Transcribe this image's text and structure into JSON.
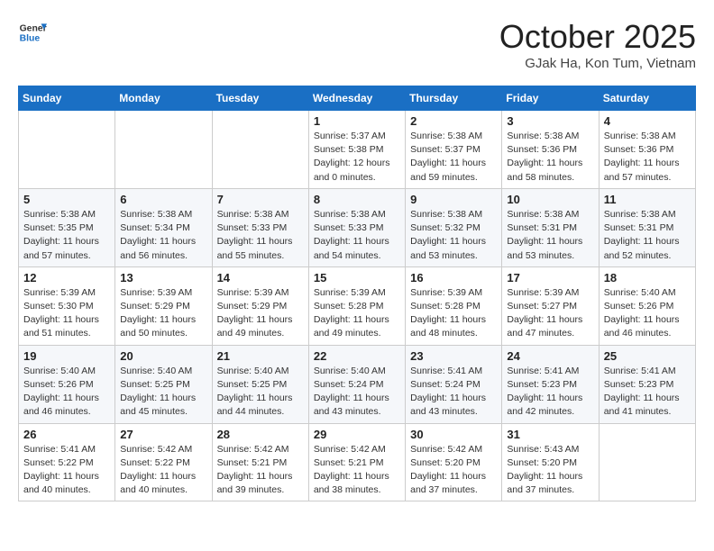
{
  "header": {
    "logo_line1": "General",
    "logo_line2": "Blue",
    "month": "October 2025",
    "location": "GJak Ha, Kon Tum, Vietnam"
  },
  "days_of_week": [
    "Sunday",
    "Monday",
    "Tuesday",
    "Wednesday",
    "Thursday",
    "Friday",
    "Saturday"
  ],
  "weeks": [
    [
      {
        "day": "",
        "info": ""
      },
      {
        "day": "",
        "info": ""
      },
      {
        "day": "",
        "info": ""
      },
      {
        "day": "1",
        "info": "Sunrise: 5:37 AM\nSunset: 5:38 PM\nDaylight: 12 hours\nand 0 minutes."
      },
      {
        "day": "2",
        "info": "Sunrise: 5:38 AM\nSunset: 5:37 PM\nDaylight: 11 hours\nand 59 minutes."
      },
      {
        "day": "3",
        "info": "Sunrise: 5:38 AM\nSunset: 5:36 PM\nDaylight: 11 hours\nand 58 minutes."
      },
      {
        "day": "4",
        "info": "Sunrise: 5:38 AM\nSunset: 5:36 PM\nDaylight: 11 hours\nand 57 minutes."
      }
    ],
    [
      {
        "day": "5",
        "info": "Sunrise: 5:38 AM\nSunset: 5:35 PM\nDaylight: 11 hours\nand 57 minutes."
      },
      {
        "day": "6",
        "info": "Sunrise: 5:38 AM\nSunset: 5:34 PM\nDaylight: 11 hours\nand 56 minutes."
      },
      {
        "day": "7",
        "info": "Sunrise: 5:38 AM\nSunset: 5:33 PM\nDaylight: 11 hours\nand 55 minutes."
      },
      {
        "day": "8",
        "info": "Sunrise: 5:38 AM\nSunset: 5:33 PM\nDaylight: 11 hours\nand 54 minutes."
      },
      {
        "day": "9",
        "info": "Sunrise: 5:38 AM\nSunset: 5:32 PM\nDaylight: 11 hours\nand 53 minutes."
      },
      {
        "day": "10",
        "info": "Sunrise: 5:38 AM\nSunset: 5:31 PM\nDaylight: 11 hours\nand 53 minutes."
      },
      {
        "day": "11",
        "info": "Sunrise: 5:38 AM\nSunset: 5:31 PM\nDaylight: 11 hours\nand 52 minutes."
      }
    ],
    [
      {
        "day": "12",
        "info": "Sunrise: 5:39 AM\nSunset: 5:30 PM\nDaylight: 11 hours\nand 51 minutes."
      },
      {
        "day": "13",
        "info": "Sunrise: 5:39 AM\nSunset: 5:29 PM\nDaylight: 11 hours\nand 50 minutes."
      },
      {
        "day": "14",
        "info": "Sunrise: 5:39 AM\nSunset: 5:29 PM\nDaylight: 11 hours\nand 49 minutes."
      },
      {
        "day": "15",
        "info": "Sunrise: 5:39 AM\nSunset: 5:28 PM\nDaylight: 11 hours\nand 49 minutes."
      },
      {
        "day": "16",
        "info": "Sunrise: 5:39 AM\nSunset: 5:28 PM\nDaylight: 11 hours\nand 48 minutes."
      },
      {
        "day": "17",
        "info": "Sunrise: 5:39 AM\nSunset: 5:27 PM\nDaylight: 11 hours\nand 47 minutes."
      },
      {
        "day": "18",
        "info": "Sunrise: 5:40 AM\nSunset: 5:26 PM\nDaylight: 11 hours\nand 46 minutes."
      }
    ],
    [
      {
        "day": "19",
        "info": "Sunrise: 5:40 AM\nSunset: 5:26 PM\nDaylight: 11 hours\nand 46 minutes."
      },
      {
        "day": "20",
        "info": "Sunrise: 5:40 AM\nSunset: 5:25 PM\nDaylight: 11 hours\nand 45 minutes."
      },
      {
        "day": "21",
        "info": "Sunrise: 5:40 AM\nSunset: 5:25 PM\nDaylight: 11 hours\nand 44 minutes."
      },
      {
        "day": "22",
        "info": "Sunrise: 5:40 AM\nSunset: 5:24 PM\nDaylight: 11 hours\nand 43 minutes."
      },
      {
        "day": "23",
        "info": "Sunrise: 5:41 AM\nSunset: 5:24 PM\nDaylight: 11 hours\nand 43 minutes."
      },
      {
        "day": "24",
        "info": "Sunrise: 5:41 AM\nSunset: 5:23 PM\nDaylight: 11 hours\nand 42 minutes."
      },
      {
        "day": "25",
        "info": "Sunrise: 5:41 AM\nSunset: 5:23 PM\nDaylight: 11 hours\nand 41 minutes."
      }
    ],
    [
      {
        "day": "26",
        "info": "Sunrise: 5:41 AM\nSunset: 5:22 PM\nDaylight: 11 hours\nand 40 minutes."
      },
      {
        "day": "27",
        "info": "Sunrise: 5:42 AM\nSunset: 5:22 PM\nDaylight: 11 hours\nand 40 minutes."
      },
      {
        "day": "28",
        "info": "Sunrise: 5:42 AM\nSunset: 5:21 PM\nDaylight: 11 hours\nand 39 minutes."
      },
      {
        "day": "29",
        "info": "Sunrise: 5:42 AM\nSunset: 5:21 PM\nDaylight: 11 hours\nand 38 minutes."
      },
      {
        "day": "30",
        "info": "Sunrise: 5:42 AM\nSunset: 5:20 PM\nDaylight: 11 hours\nand 37 minutes."
      },
      {
        "day": "31",
        "info": "Sunrise: 5:43 AM\nSunset: 5:20 PM\nDaylight: 11 hours\nand 37 minutes."
      },
      {
        "day": "",
        "info": ""
      }
    ]
  ]
}
